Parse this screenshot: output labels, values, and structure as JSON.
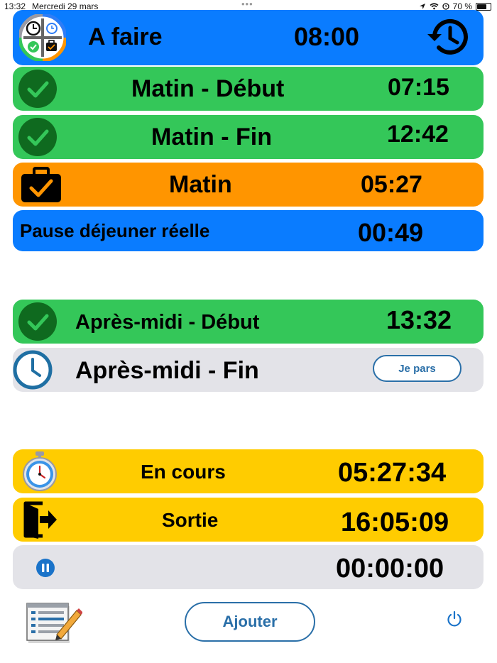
{
  "status_bar": {
    "time": "13:32",
    "date": "Mercredi 29 mars",
    "battery": "70 %"
  },
  "header": {
    "title": "A faire",
    "time": "08:00",
    "app_icon": "clock-plus-checklist-icon",
    "history_icon": "history-icon"
  },
  "morning": {
    "start": {
      "label": "Matin - Début",
      "time": "07:15"
    },
    "end": {
      "label": "Matin - Fin",
      "time": "12:42"
    },
    "total": {
      "label": "Matin",
      "time": "05:27",
      "icon": "briefcase-check-icon"
    },
    "lunch": {
      "label": "Pause déjeuner réelle",
      "time": "00:49"
    }
  },
  "afternoon": {
    "start": {
      "label": "Après-midi - Début",
      "time": "13:32"
    },
    "end": {
      "label": "Après-midi - Fin",
      "button": "Je pars",
      "icon": "clock-icon"
    }
  },
  "counters": {
    "running": {
      "label": "En cours",
      "time": "05:27:34",
      "icon": "stopwatch-icon"
    },
    "exit": {
      "label": "Sortie",
      "time": "16:05:09",
      "icon": "exit-icon"
    },
    "pause": {
      "time": "00:00:00",
      "icon": "pause-icon"
    }
  },
  "footer": {
    "add_button": "Ajouter",
    "list_icon": "notepad-pencil-icon",
    "power_icon": "power-icon"
  },
  "colors": {
    "blue": "#0a7cff",
    "green": "#34c759",
    "orange": "#ff9500",
    "yellow": "#ffcc00",
    "grey": "#e3e3e8",
    "dark_green": "#0f6a1f",
    "outline_blue": "#2a6fa8"
  }
}
